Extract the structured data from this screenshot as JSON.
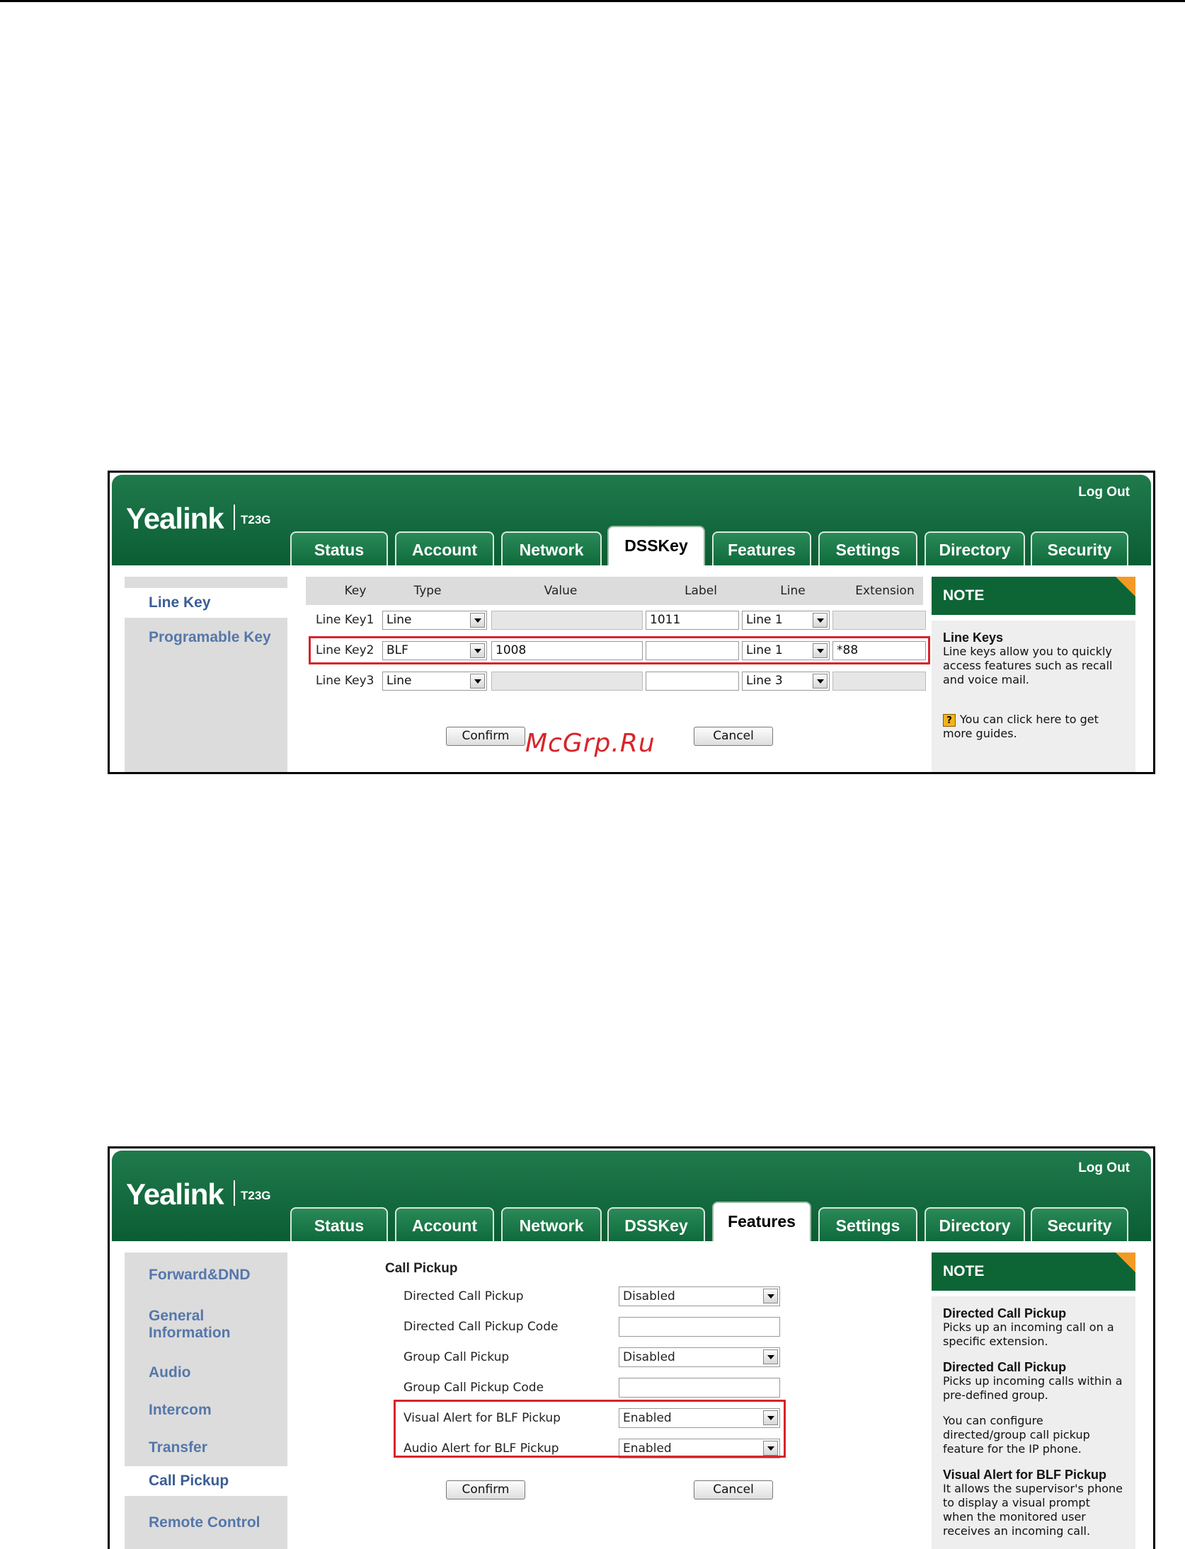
{
  "watermark": "McGrp.Ru",
  "shot1": {
    "logout": "Log Out",
    "brand": "Yealink",
    "model": "T23G",
    "tabs": [
      "Status",
      "Account",
      "Network",
      "DSSKey",
      "Features",
      "Settings",
      "Directory",
      "Security"
    ],
    "active_tab": "DSSKey",
    "nav": [
      "Line Key",
      "Programable Key"
    ],
    "active_nav": "Line Key",
    "headers": {
      "key": "Key",
      "type": "Type",
      "value": "Value",
      "label": "Label",
      "line": "Line",
      "extension": "Extension"
    },
    "rows": [
      {
        "key": "Line Key1",
        "type": "Line",
        "value": "",
        "label": "1011",
        "line": "Line 1",
        "extension": ""
      },
      {
        "key": "Line Key2",
        "type": "BLF",
        "value": "1008",
        "label": "",
        "line": "Line 1",
        "extension": "*88"
      },
      {
        "key": "Line Key3",
        "type": "Line",
        "value": "",
        "label": "",
        "line": "Line 3",
        "extension": ""
      }
    ],
    "confirm": "Confirm",
    "cancel": "Cancel",
    "note": {
      "title": "NOTE",
      "heading": "Line Keys",
      "text": "Line keys allow you to quickly access features such as recall and voice mail.",
      "guide": "You can click here to get more guides."
    }
  },
  "shot2": {
    "logout": "Log Out",
    "brand": "Yealink",
    "model": "T23G",
    "tabs": [
      "Status",
      "Account",
      "Network",
      "DSSKey",
      "Features",
      "Settings",
      "Directory",
      "Security"
    ],
    "active_tab": "Features",
    "nav": [
      "Forward&DND",
      "General Information",
      "Audio",
      "Intercom",
      "Transfer",
      "Call Pickup",
      "Remote Control"
    ],
    "active_nav": "Call Pickup",
    "section_title": "Call Pickup",
    "fields": [
      {
        "label": "Directed Call Pickup",
        "value": "Disabled",
        "kind": "select"
      },
      {
        "label": "Directed Call Pickup Code",
        "value": "",
        "kind": "text"
      },
      {
        "label": "Group Call Pickup",
        "value": "Disabled",
        "kind": "select"
      },
      {
        "label": "Group Call Pickup Code",
        "value": "",
        "kind": "text"
      },
      {
        "label": "Visual Alert for BLF Pickup",
        "value": "Enabled",
        "kind": "select"
      },
      {
        "label": "Audio Alert for BLF Pickup",
        "value": "Enabled",
        "kind": "select"
      }
    ],
    "confirm": "Confirm",
    "cancel": "Cancel",
    "note": {
      "title": "NOTE",
      "items": [
        {
          "heading": "Directed Call Pickup",
          "text": "Picks up an incoming call on a specific extension."
        },
        {
          "heading": "Directed Call Pickup",
          "text": "Picks up incoming calls within a pre-defined group."
        },
        {
          "heading": "",
          "text": "You can configure directed/group call pickup feature for the IP phone."
        },
        {
          "heading": "Visual Alert for BLF Pickup",
          "text": "It allows the supervisor's phone to display a visual prompt when the monitored user receives an incoming call."
        }
      ]
    }
  }
}
